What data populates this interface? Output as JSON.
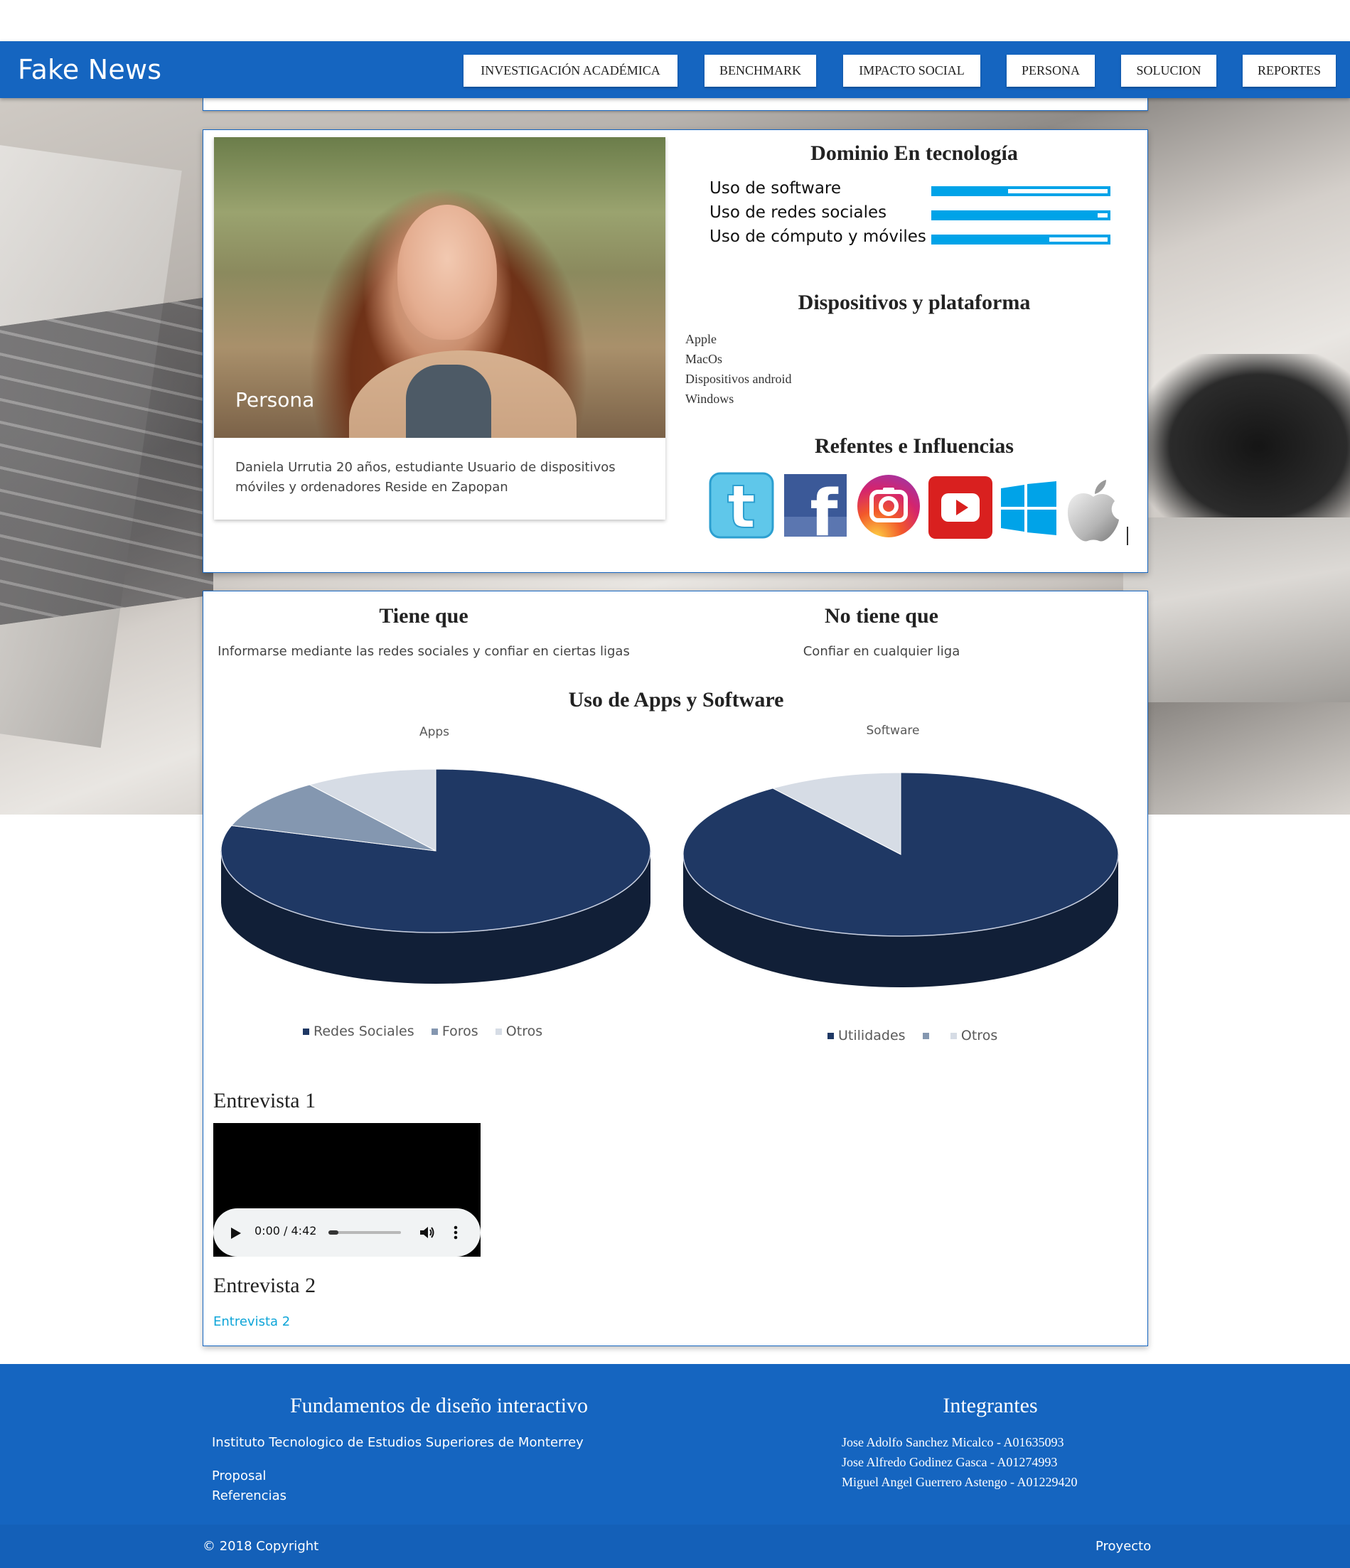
{
  "navbar": {
    "brand": "Fake News",
    "items": [
      {
        "label": "INVESTIGACIÓN ACADÉMICA"
      },
      {
        "label": "BENCHMARK"
      },
      {
        "label": "IMPACTO SOCIAL"
      },
      {
        "label": "PERSONA"
      },
      {
        "label": "SOLUCION"
      },
      {
        "label": "REPORTES"
      }
    ]
  },
  "persona": {
    "caption": "Persona",
    "description": "Daniela Urrutia 20 años, estudiante Usuario de dispositivos móviles y ordenadores Reside en Zapopan"
  },
  "domain": {
    "title": "Dominio En tecnología",
    "skills": [
      {
        "label": "Uso de software",
        "level": 0.43
      },
      {
        "label": "Uso de redes sociales",
        "level": 0.93
      },
      {
        "label": "Uso de cómputo y móviles",
        "level": 0.66
      }
    ],
    "bar_color": "#00a3e8"
  },
  "devices": {
    "title": "Dispositivos y plataforma",
    "items": [
      "Apple",
      "MacOs",
      "Dispositivos android",
      "Windows"
    ]
  },
  "influences": {
    "title": "Refentes e Influencias",
    "icons": [
      "twitter-icon",
      "facebook-icon",
      "instagram-icon",
      "youtube-icon",
      "windows-icon",
      "apple-icon"
    ]
  },
  "tiene_que": {
    "title": "Tiene que",
    "text": "Informarse mediante las redes sociales y confiar en ciertas ligas"
  },
  "no_tiene_que": {
    "title": "No tiene que",
    "text": "Confiar en cualquier liga"
  },
  "apps_software": {
    "title": "Uso de Apps y Software"
  },
  "chart_data": [
    {
      "type": "pie",
      "title": "Apps",
      "categories": [
        "Redes Sociales",
        "Foros",
        "Otros"
      ],
      "values": [
        80,
        10,
        10
      ],
      "colors": [
        "#1f3864",
        "#8497b0",
        "#d6dce5"
      ]
    },
    {
      "type": "pie",
      "title": "Software",
      "categories": [
        "Utilidades",
        "",
        "Otros"
      ],
      "values": [
        90,
        0,
        10
      ],
      "colors": [
        "#1f3864",
        "#8497b0",
        "#d6dce5"
      ]
    }
  ],
  "interviews": {
    "first_title": "Entrevista 1",
    "audio_time": "0:00 / 4:42",
    "audio_progress": 0.0,
    "second_title": "Entrevista 2",
    "second_link": "Entrevista 2"
  },
  "footer": {
    "course_title": "Fundamentos de diseño interactivo",
    "institution": "Instituto Tecnologico de Estudios Superiores de Monterrey",
    "links": [
      "Proposal",
      "Referencias"
    ],
    "members_title": "Integrantes",
    "members": [
      "Jose Adolfo Sanchez Micalco - A01635093",
      "Jose Alfredo Godinez Gasca - A01274993",
      "Miguel Angel Guerrero Astengo - A01229420"
    ],
    "copyright": "© 2018 Copyright",
    "project": "Proyecto"
  },
  "colors": {
    "primary": "#1565c0",
    "accent_bar": "#00a3e8",
    "link": "#0ea5d8"
  }
}
